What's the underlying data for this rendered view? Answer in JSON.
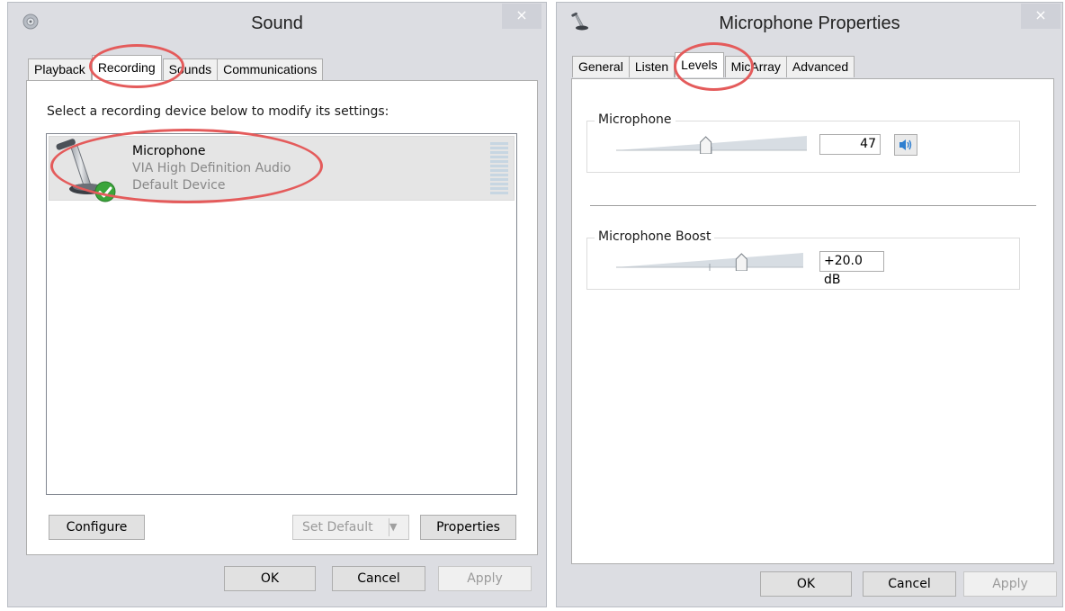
{
  "sound_window": {
    "title": "Sound",
    "close_label": "×",
    "tabs": [
      "Playback",
      "Recording",
      "Sounds",
      "Communications"
    ],
    "active_tab": "Recording",
    "instruction": "Select a recording device below to modify its settings:",
    "device": {
      "name": "Microphone",
      "driver": "VIA High Definition Audio",
      "status": "Default Device"
    },
    "buttons": {
      "configure": "Configure",
      "set_default": "Set Default",
      "properties": "Properties",
      "ok": "OK",
      "cancel": "Cancel",
      "apply": "Apply"
    }
  },
  "mic_window": {
    "title": "Microphone Properties",
    "close_label": "×",
    "tabs": [
      "General",
      "Listen",
      "Levels",
      "MicArray",
      "Advanced"
    ],
    "active_tab": "Levels",
    "microphone": {
      "label": "Microphone",
      "value": "47",
      "level": 0.47
    },
    "boost": {
      "label": "Microphone Boost",
      "value": "+20.0 dB",
      "level": 0.67
    },
    "buttons": {
      "ok": "OK",
      "cancel": "Cancel",
      "apply": "Apply"
    }
  },
  "colors": {
    "annotation": "#e45b5b",
    "window_bg": "#dcdde2",
    "check_green": "#3aa53a",
    "speaker_blue": "#2f7fd0"
  },
  "icons": [
    "sound-icon",
    "microphone-icon",
    "default-check-icon",
    "level-meter-icon",
    "speaker-icon",
    "close-icon"
  ]
}
